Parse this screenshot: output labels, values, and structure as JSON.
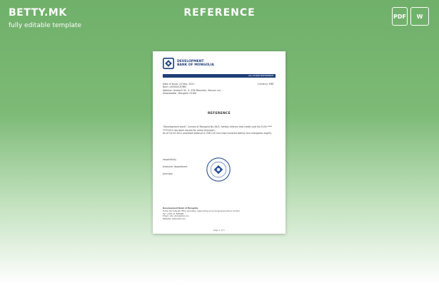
{
  "brand": {
    "logo": "BETTY.MK",
    "tagline": "fully editable template"
  },
  "header": {
    "title": "REFERENCE"
  },
  "formats": {
    "pdf_label": "PDF",
    "word_label": "W"
  },
  "document": {
    "bank_name_line1": "DEVELOPMENT",
    "bank_name_line2": "BANK OF MONGOLIA",
    "bar_text": "ALL STORE REFERENCE",
    "meta_line1": "Date of Issue: 24 Nov, 2021",
    "meta_line2": "Num: c/0000/CIF/MN",
    "meta_line3": "Address: Ikhtamir St., 4, 436 Mountain, Baruun uul ...",
    "meta_line4": "Ulaanbaatar, Mongolia 15160",
    "meta_right": "Currency: MNT",
    "title": "REFERENCE",
    "body_para1": "\"Development bank\", license of Mongolia No 26/3, hereby informs that credit card No 5154 **** ****2222 has been issued for name Unknown.",
    "body_para2": "As of 24.03.2021 available balance is 336 120 mnt (two hundred twenty four mongolian tugrik).",
    "sign_line1": "respectfully,",
    "sign_line2": "treasurer department",
    "sign_line3": "principal",
    "seal_text": "DEVELOPMENT BANK · MONGOLIA",
    "footer_line1": "Development Bank of Mongolia",
    "footer_line2": "Prime Secretariat office operation responding account general phone central",
    "footer_line3": "Tel: +976 11 500000",
    "footer_line4": "Email: info_dbm@dbm.mn",
    "footer_line5": "Website: www.dbm.mn",
    "page_number": "Page 1 of 1"
  },
  "colors": {
    "bank_blue": "#1f3f7a",
    "green_top": "#6fb06a"
  }
}
